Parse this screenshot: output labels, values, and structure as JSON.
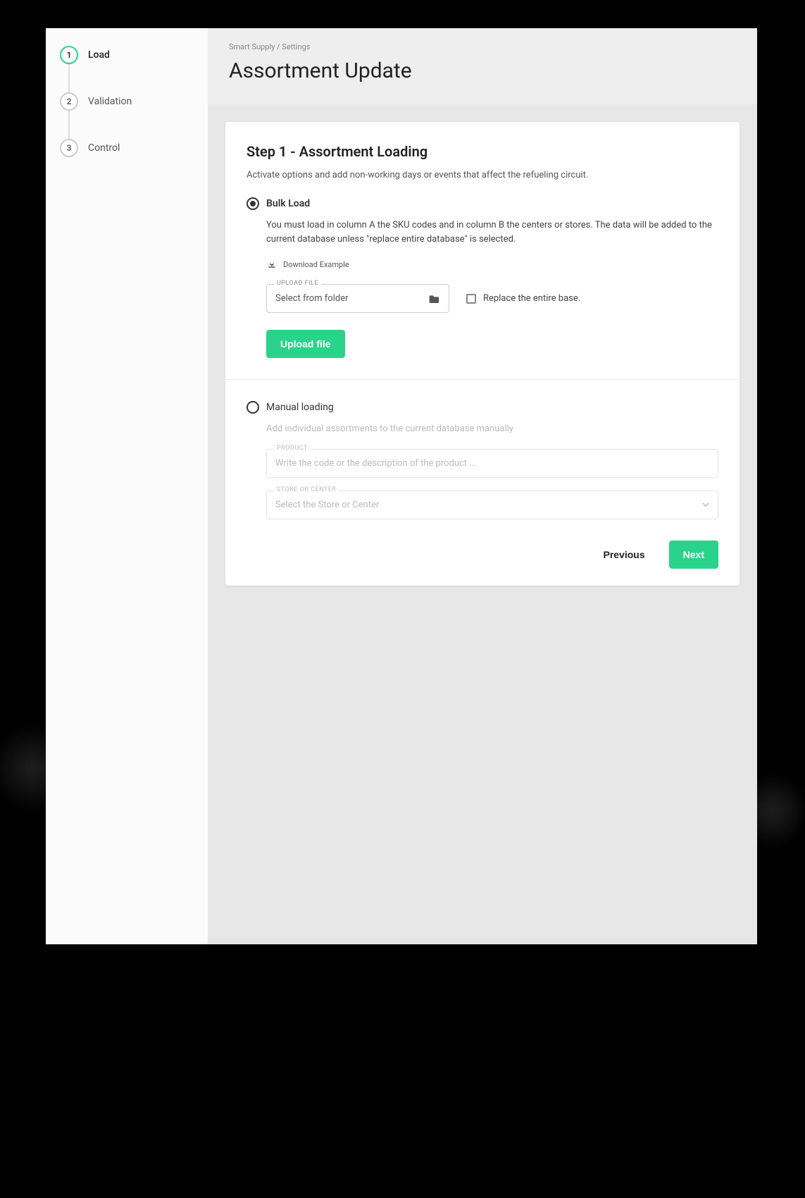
{
  "sidebar": {
    "steps": [
      {
        "num": "1",
        "label": "Load",
        "active": true
      },
      {
        "num": "2",
        "label": "Validation",
        "active": false
      },
      {
        "num": "3",
        "label": "Control",
        "active": false
      }
    ]
  },
  "header": {
    "breadcrumb": "Smart Supply / Settings",
    "title": "Assortment Update"
  },
  "card": {
    "title": "Step 1 - Assortment Loading",
    "subtitle": "Activate options and add non-working days or events that affect the refueling circuit.",
    "bulk": {
      "radio_label": "Bulk Load",
      "desc": "You must load in column A the SKU codes and in column B the centers or stores. The data will be added to the current database unless \"replace entire database\" is selected.",
      "download_label": "Download Example",
      "upload_legend": "UPLOAD FILE",
      "upload_placeholder": "Select from folder",
      "replace_label": "Replace the entire base.",
      "upload_btn": "Upload file"
    },
    "manual": {
      "radio_label": "Manual loading",
      "desc": "Add individual assortments to the current database manually",
      "product_legend": "PRODUCT",
      "product_placeholder": "Write the code or the description of the product ...",
      "store_legend": "STORE OR CENTER",
      "store_placeholder": "Select the Store or Center"
    },
    "footer": {
      "previous": "Previous",
      "next": "Next"
    }
  }
}
